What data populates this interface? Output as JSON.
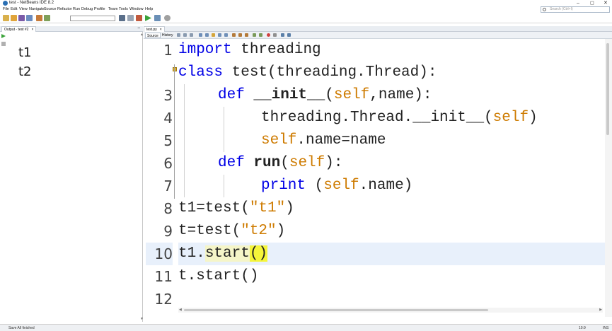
{
  "window": {
    "title": "test - NetBeans IDE 8.2",
    "minimize": "–",
    "maximize": "◻",
    "close": "✕"
  },
  "menu": [
    "File",
    "Edit",
    "View",
    "Navigate",
    "Source",
    "Refactor",
    "Run",
    "Debug",
    "Profile",
    "Team",
    "Tools",
    "Window",
    "Help"
  ],
  "search": {
    "placeholder": "Search (Ctrl+I)"
  },
  "output": {
    "tab_label": "Output - test #2",
    "lines": [
      "t1",
      "t2"
    ]
  },
  "editor": {
    "tab_label": "test.py",
    "mode_tabs": [
      "Source",
      "History"
    ],
    "line_numbers": [
      "1",
      "",
      "3",
      "4",
      "5",
      "6",
      "7",
      "8",
      "9",
      "10",
      "11",
      "12"
    ],
    "code": {
      "l1_kw": "import",
      "l1_rest": " threading",
      "l2_kw": "class",
      "l2_rest": " test(threading.Thread):",
      "l3_kw": "def",
      "l3_fn": "__init__",
      "l3_open": "(",
      "l3_self": "self",
      "l3_rest": ",name):",
      "l4_pre": "threading.Thread.__init__(",
      "l4_self": "self",
      "l4_end": ")",
      "l5_self": "self",
      "l5_rest": ".name=name",
      "l6_kw": "def",
      "l6_fn": "run",
      "l6_open": "(",
      "l6_self": "self",
      "l6_end": "):",
      "l7_kw": "print",
      "l7_open": " (",
      "l7_self": "self",
      "l7_end": ".name)",
      "l8_pre": "t1=test(",
      "l8_str": "\"t1\"",
      "l8_end": ")",
      "l9_pre": "t=test(",
      "l9_str": "\"t2\"",
      "l9_end": ")",
      "l10_pre": "t1.",
      "l10_mid": "start",
      "l10_end": "()",
      "l11": "t.start()"
    }
  },
  "status": {
    "message": "Save All finished",
    "position": "10:9",
    "insert": "INS"
  },
  "colors": {
    "keyword": "#0000e6",
    "self": "#ce7b00",
    "highlight": "#f5f53a",
    "current_line": "#e8f0fb"
  }
}
